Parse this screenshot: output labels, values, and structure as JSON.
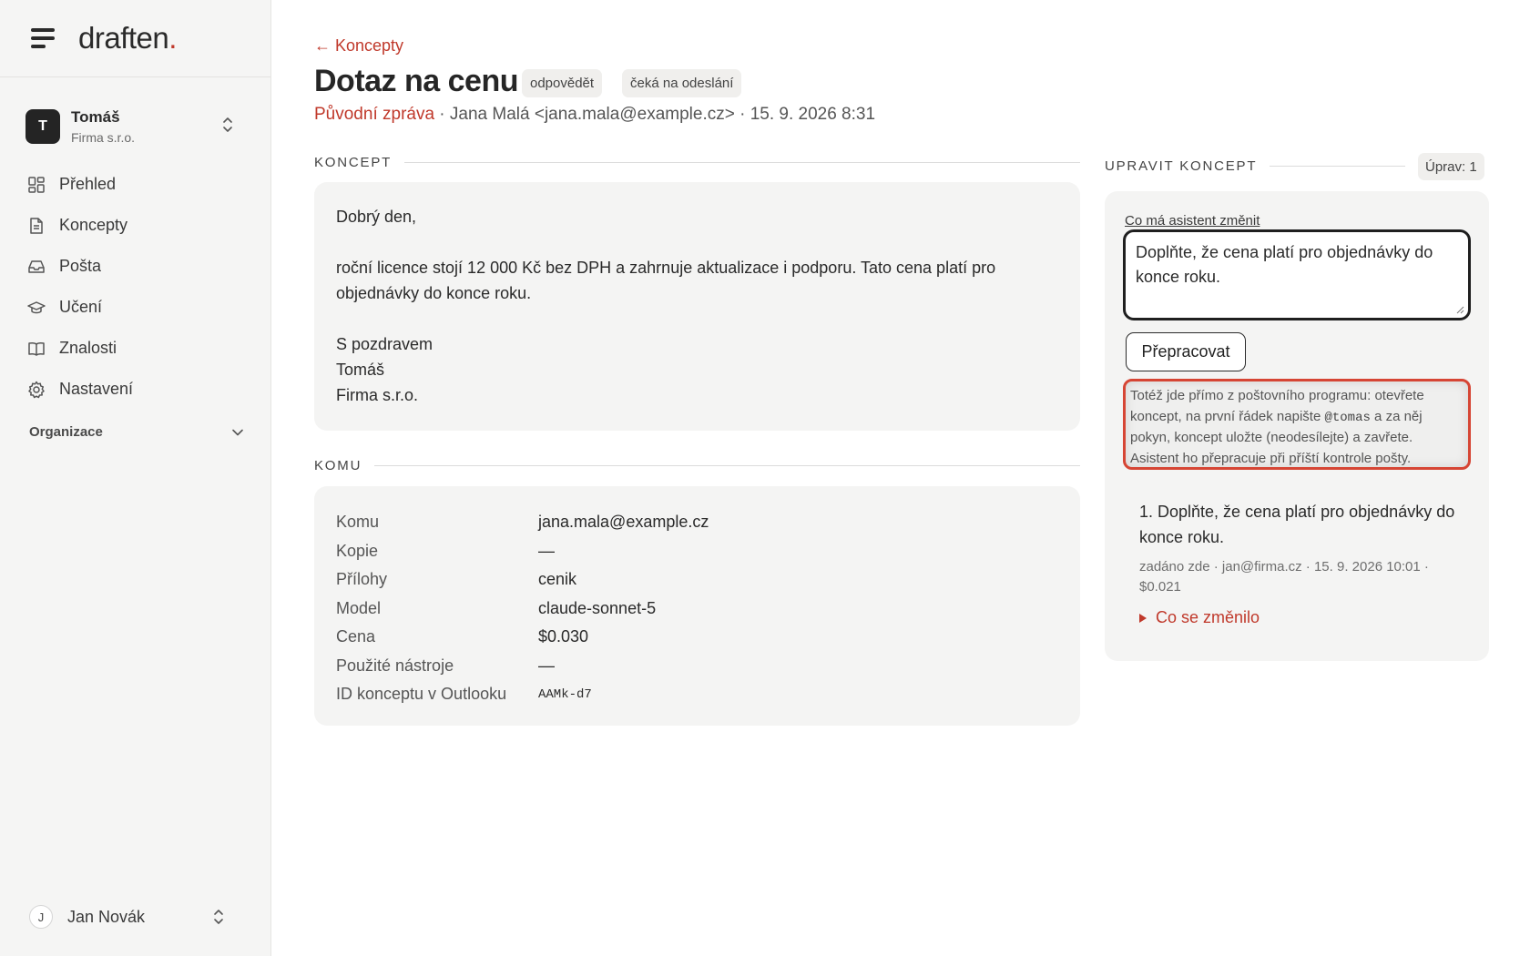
{
  "brand": {
    "name": "draften",
    "dot": "."
  },
  "account": {
    "initial": "T",
    "name": "Tomáš",
    "org": "Firma s.r.o."
  },
  "nav": {
    "items": [
      {
        "label": "Přehled",
        "icon": "dashboard-icon"
      },
      {
        "label": "Koncepty",
        "icon": "document-icon"
      },
      {
        "label": "Pošta",
        "icon": "inbox-icon"
      },
      {
        "label": "Učení",
        "icon": "graduation-cap-icon"
      },
      {
        "label": "Znalosti",
        "icon": "book-icon"
      },
      {
        "label": "Nastavení",
        "icon": "gear-icon"
      }
    ],
    "organizations_label": "Organizace"
  },
  "user": {
    "initial": "J",
    "name": "Jan Novák"
  },
  "header": {
    "back_label": "← Koncepty",
    "title": "Dotaz na cenu",
    "badges": [
      "odpovědět",
      "čeká na odeslání"
    ],
    "original_label": "Původní zpráva",
    "meta": " · Jana Malá <jana.mala@example.cz> · 15. 9. 2026 8:31"
  },
  "draft": {
    "section_label": "KONCEPT",
    "lines": [
      "Dobrý den,",
      "roční licence stojí 12 000 Kč bez DPH a zahrnuje aktualizace i podporu. Tato cena platí pro objednávky do konce roku.",
      "S pozdravem",
      "Tomáš",
      "Firma s.r.o."
    ]
  },
  "komu": {
    "section_label": "KOMU",
    "rows": [
      {
        "key": "Komu",
        "value": "jana.mala@example.cz"
      },
      {
        "key": "Kopie",
        "value": "—"
      },
      {
        "key": "Přílohy",
        "value": "cenik"
      },
      {
        "key": "Model",
        "value": "claude-sonnet-5"
      },
      {
        "key": "Cena",
        "value": "$0.030"
      },
      {
        "key": "Použité nástroje",
        "value": "—"
      },
      {
        "key": "ID konceptu v Outlooku",
        "value": "AAMk-d7"
      }
    ]
  },
  "edit": {
    "section_label": "UPRAVIT KONCEPT",
    "count_label": "Úprav: 1",
    "question_label": "Co má asistent změnit",
    "textarea_value": "Doplňte, že cena platí pro objednávky do konce roku.",
    "rework_label": "Přepracovat",
    "hint_before": "Totéž jde přímo z poštovního programu: otevřete koncept, na první řádek napište ",
    "hint_code": "@tomas",
    "hint_after": " a za něj pokyn, koncept uložte (neodesílejte) a zavřete. Asistent ho přepracuje při příští kontrole pošty.",
    "history": {
      "title": "1. Doplňte, že cena platí pro objednávky do konce roku.",
      "sub": "zadáno zde · jan@firma.cz · 15. 9. 2026 10:01 · $0.021",
      "changed_label": "Co se změnilo"
    }
  },
  "colors": {
    "accent": "#c0392b",
    "card": "#f4f4f3",
    "sidebar": "#f5f5f4",
    "highlight": "#d64534"
  }
}
